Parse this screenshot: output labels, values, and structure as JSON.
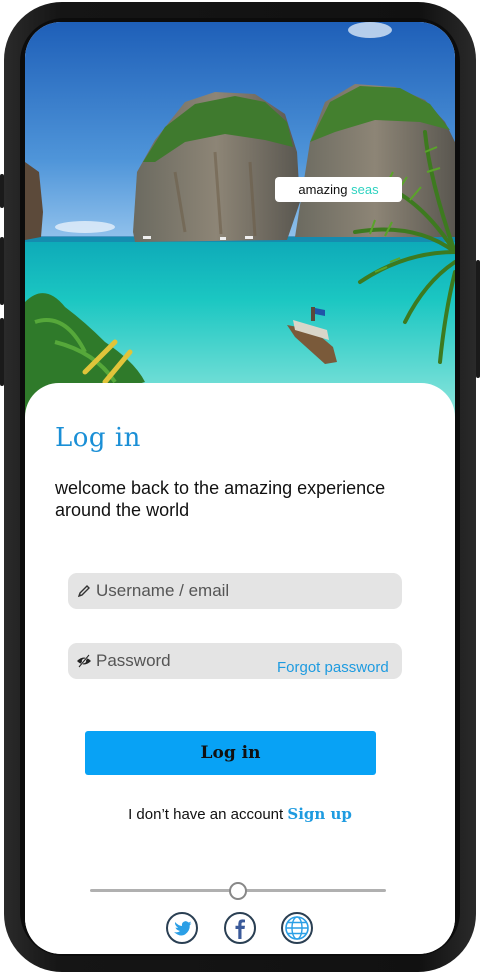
{
  "hero": {
    "tag_prefix": "amazing",
    "tag_accent": "seas",
    "accent_color": "#2fd2c0"
  },
  "login": {
    "title": "Log in",
    "subtitle": "welcome back to the amazing experience around the world",
    "username": {
      "placeholder": "Username / email",
      "icon": "pencil-icon"
    },
    "password": {
      "placeholder": "Password",
      "icon": "eye-slash-icon"
    },
    "forgot_label": "Forgot password",
    "login_label": "Log in",
    "account_text": "I don’t have an account",
    "signup_label": "Sign up"
  },
  "slider": {
    "value": 0.5
  },
  "social": [
    {
      "name": "twitter-icon"
    },
    {
      "name": "facebook-icon"
    },
    {
      "name": "globe-icon"
    }
  ],
  "colors": {
    "brand": "#1a8fd6",
    "button": "#08a2f5",
    "field": "#e4e4e4"
  }
}
